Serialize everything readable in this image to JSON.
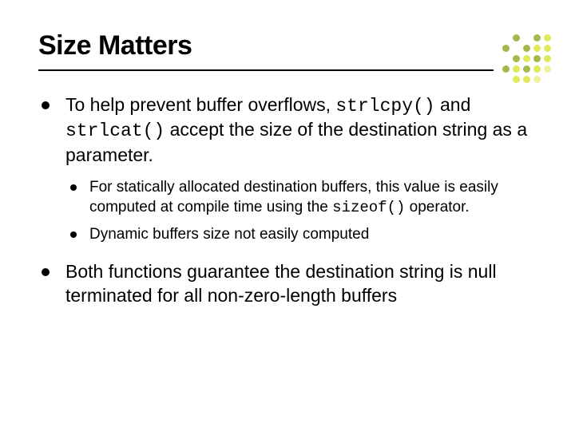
{
  "slide": {
    "title": "Size Matters",
    "bullets": [
      {
        "pre": "To help prevent buffer overflows, ",
        "code1": "strlcpy()",
        "mid": " and ",
        "code2": "strlcat()",
        "post": " accept the size of the destination string as a parameter.",
        "sub": [
          {
            "pre": "For statically allocated destination buffers, this value is easily computed at compile time using the ",
            "code": "sizeof()",
            "post": " operator."
          },
          {
            "text": "Dynamic buffers size not easily computed"
          }
        ]
      },
      {
        "text": "Both functions guarantee the destination string is null terminated for all non-zero-length buffers"
      }
    ]
  },
  "deco_colors": [
    [
      "",
      "",
      "",
      "",
      "",
      ""
    ],
    [
      "",
      "",
      "#a6b84c",
      "",
      "#a6b84c",
      "#e0e95a"
    ],
    [
      "",
      "#a6b84c",
      "",
      "#a6b84c",
      "#e0e95a",
      "#e0e95a"
    ],
    [
      "",
      "",
      "#a6b84c",
      "#e0e95a",
      "#a6b84c",
      "#e0e95a"
    ],
    [
      "",
      "#a6b84c",
      "#e0e95a",
      "#a6b84c",
      "#e0e95a",
      "#eef29b"
    ],
    [
      "",
      "",
      "#e0e95a",
      "#e0e95a",
      "#eef29b",
      ""
    ]
  ]
}
